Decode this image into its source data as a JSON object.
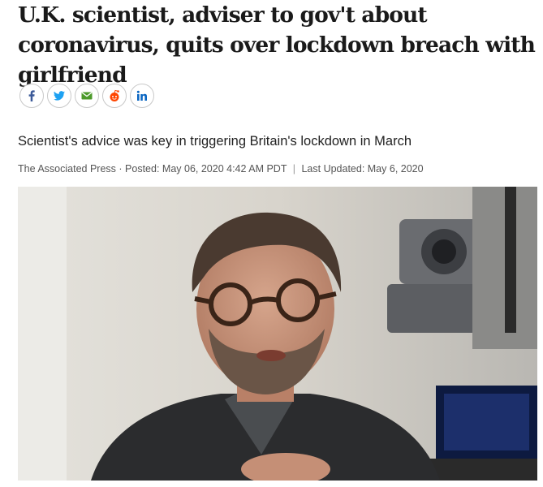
{
  "article": {
    "headline": "U.K. scientist, adviser to gov't about coronavirus, quits over lockdown breach with girlfriend",
    "deck": "Scientist's advice was key in triggering Britain's lockdown in March",
    "byline": {
      "source": "The Associated Press",
      "separator_dot": "·",
      "posted": "Posted: May 06, 2020 4:42 AM PDT",
      "separator_bar": "|",
      "updated": "Last Updated: May 6, 2020"
    }
  },
  "share": {
    "buttons": [
      {
        "icon": "facebook-icon",
        "color": "#3b5998"
      },
      {
        "icon": "twitter-icon",
        "color": "#1da1f2"
      },
      {
        "icon": "email-icon",
        "color": "#4c9a2a"
      },
      {
        "icon": "reddit-icon",
        "color": "#ff4500"
      },
      {
        "icon": "linkedin-icon",
        "color": "#0a66c2"
      }
    ]
  },
  "photo": {
    "subject": "man-with-glasses-photo"
  }
}
